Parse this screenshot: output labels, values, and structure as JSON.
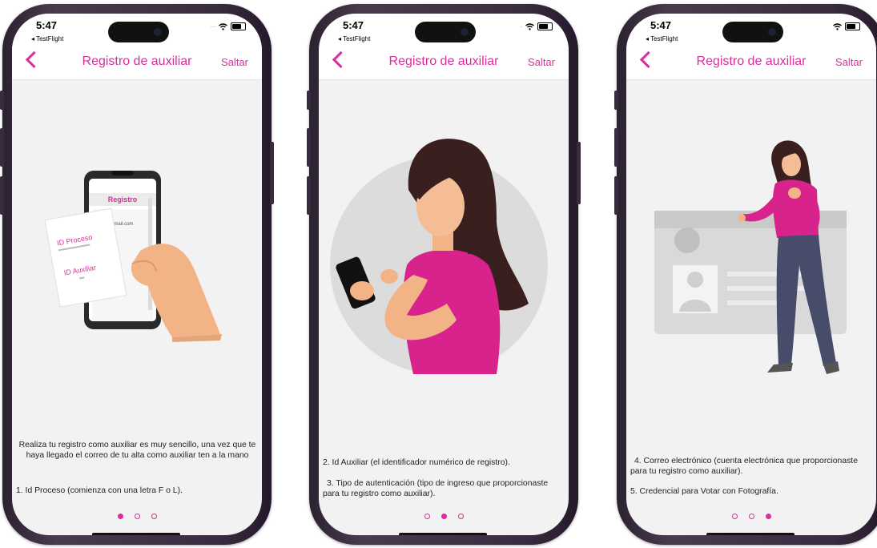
{
  "status": {
    "time": "5:47",
    "back_app": "◂ TestFlight"
  },
  "nav": {
    "title": "Registro de auxiliar",
    "skip": "Saltar"
  },
  "screens": [
    {
      "illustration": {
        "phone_header": "Registro",
        "email_hint": "@gmail.com",
        "card_line_1": "ID Proceso",
        "card_line_2": "ID Auxiliar"
      },
      "intro": "Realiza tu registro como auxiliar es muy sencillo, una vez que te haya llegado el correo de tu alta como auxiliar ten a la mano",
      "item_1": "1. Id Proceso (comienza con una letra F o L).",
      "active_page": 1
    },
    {
      "item_2": "2. Id Auxiliar (el identificador numérico de registro).",
      "item_3": "3. Tipo de autenticación (tipo de ingreso que proporcionaste para tu registro como auxiliar).",
      "active_page": 2
    },
    {
      "item_4": "4. Correo electrónico (cuenta electrónica que proporcionaste para tu registro como auxiliar).",
      "item_5": "5. Credencial para Votar con Fotografía.",
      "active_page": 3
    }
  ],
  "colors": {
    "accent": "#d92e9c",
    "frame": "#3a2c40",
    "background": "#f2f2f2"
  },
  "icons": [
    "back-chevron-icon",
    "location-arrow-icon",
    "wifi-icon",
    "battery-icon"
  ]
}
